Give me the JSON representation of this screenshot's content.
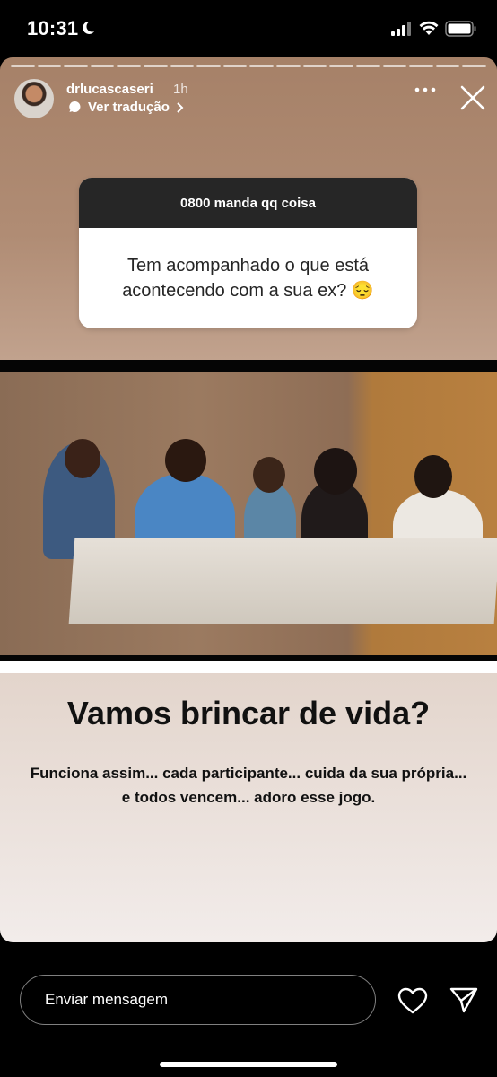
{
  "status_bar": {
    "time": "10:31"
  },
  "story": {
    "segments": 18,
    "username": "drlucascaseri",
    "age": "1h",
    "translate_label": "Ver tradução",
    "question_box": {
      "header": "0800 manda qq coisa",
      "question": "Tem acompanhado o que está acontecendo com a sua ex? 😔"
    },
    "title": "Vamos brincar de vida?",
    "body": "Funciona assim... cada participante... cuida da sua própria... e todos vencem... adoro esse jogo."
  },
  "composer": {
    "placeholder": "Enviar mensagem"
  },
  "icons": {
    "more": "more-icon",
    "close": "close-icon",
    "heart": "heart-icon",
    "send": "send-icon"
  }
}
